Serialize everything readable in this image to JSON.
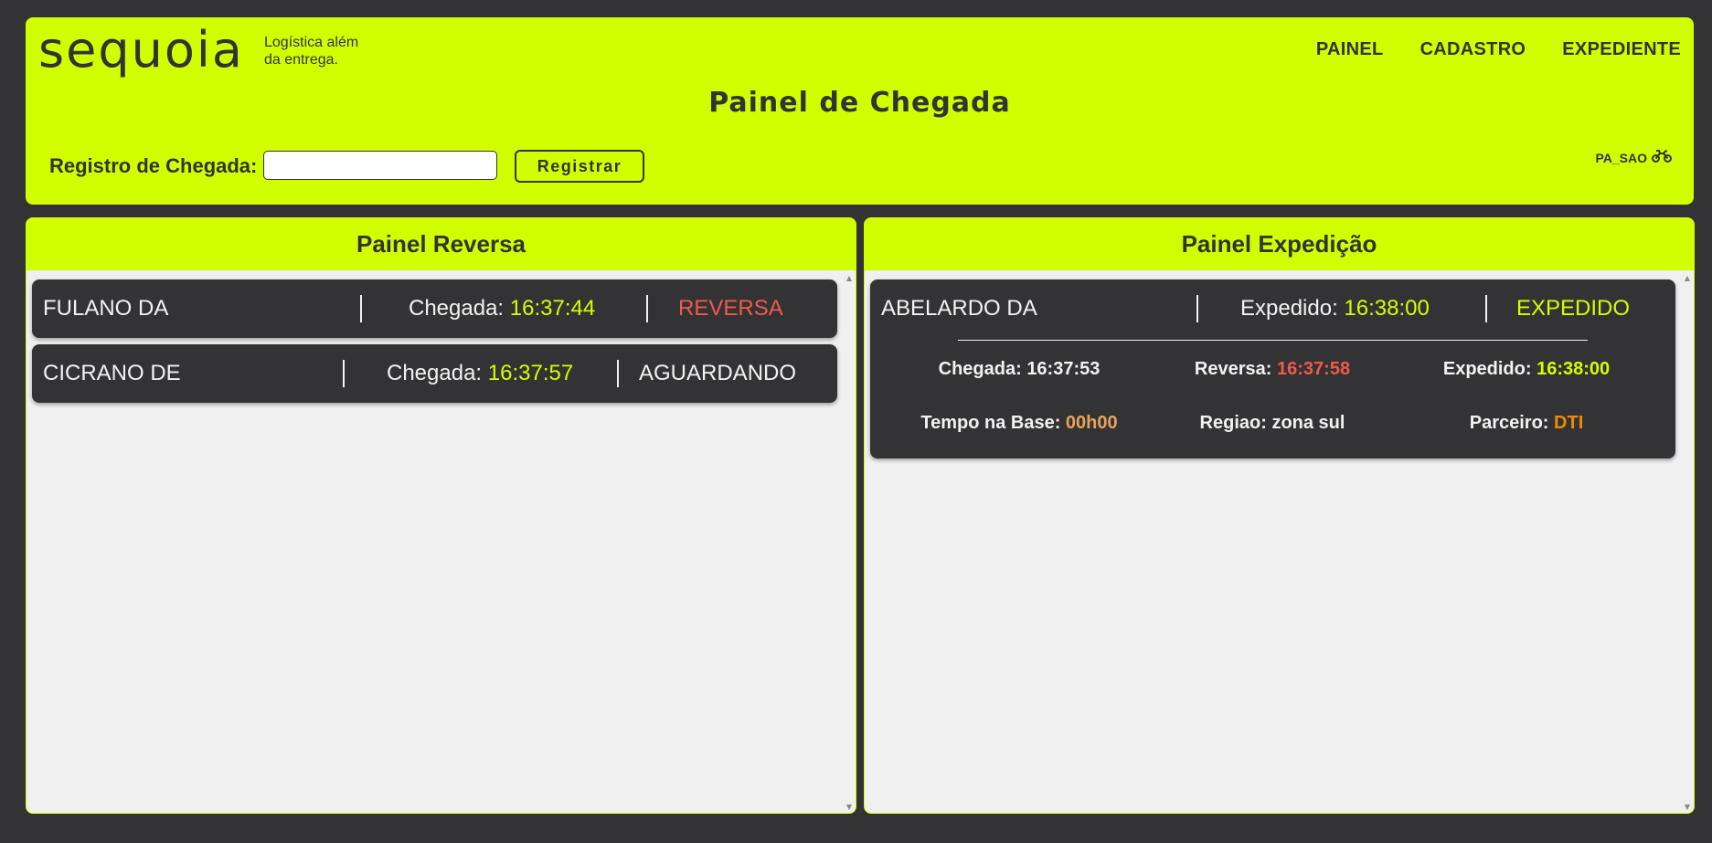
{
  "header": {
    "logo": "sequoia",
    "tagline_line1": "Logística além",
    "tagline_line2": "da entrega.",
    "nav": [
      "PAINEL",
      "CADASTRO",
      "EXPEDIENTE"
    ],
    "title": "Painel de Chegada",
    "registro_label": "Registro de Chegada:",
    "registro_value": "",
    "registrar_label": "Registrar",
    "unit_code": "PA_SAO",
    "unit_icon": "motorcycle-icon"
  },
  "reversa_panel": {
    "title": "Painel Reversa",
    "items": [
      {
        "name": "FULANO DA",
        "arrival_label": "Chegada:",
        "arrival_time": "16:37:44",
        "status": "REVERSA"
      },
      {
        "name": "CICRANO DE",
        "arrival_label": "Chegada:",
        "arrival_time": "16:37:57",
        "status": "AGUARDANDO"
      }
    ]
  },
  "expedicao_panel": {
    "title": "Painel Expedição",
    "items": [
      {
        "name": "ABELARDO DA",
        "expedido_label": "Expedido:",
        "expedido_time": "16:38:00",
        "status": "EXPEDIDO",
        "chegada_label": "Chegada:",
        "chegada_time": "16:37:53",
        "reversa_label": "Reversa:",
        "reversa_time": "16:37:58",
        "expedido_detail_label": "Expedido:",
        "expedido_detail_time": "16:38:00",
        "tempo_label": "Tempo na Base:",
        "tempo_value": "00h00",
        "regiao_label": "Regiao:",
        "regiao_value": "zona sul",
        "parceiro_label": "Parceiro:",
        "parceiro_value": "DTI"
      }
    ]
  },
  "colors": {
    "accent": "#d2ff00",
    "background": "#333335",
    "reversa": "#f05a4a",
    "parceiro": "#f08a00",
    "tempo": "#e6a45a"
  }
}
